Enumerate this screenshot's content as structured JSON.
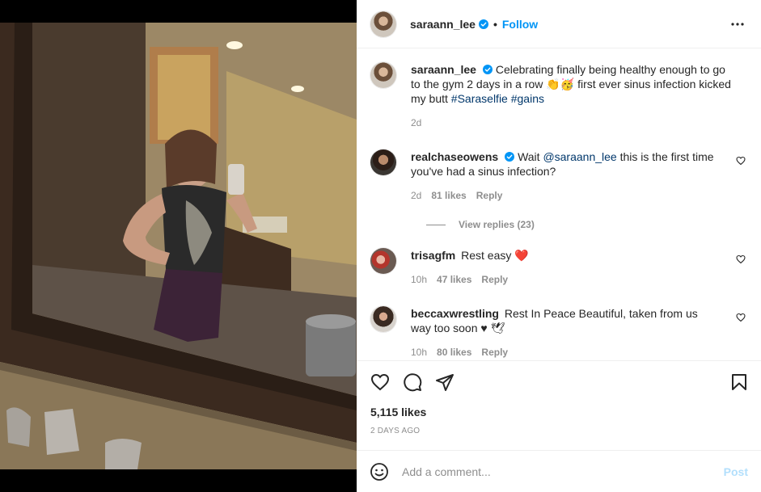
{
  "post": {
    "author": "saraann_lee",
    "follow_label": "Follow",
    "dot": "•",
    "more_icon": "more-horizontal-icon",
    "caption": {
      "text_before": "Celebrating finally being healthy enough to go to the gym 2 days in a row ",
      "emojis": "👏🥳",
      "text_after": " first ever sinus infection kicked my butt ",
      "hashtag1": "#Saraselfie",
      "hashtag2": "#gains",
      "time": "2d"
    }
  },
  "comments": [
    {
      "user": "realchaseowens",
      "verified": true,
      "text_before": "Wait ",
      "mention": "@saraann_lee",
      "text_after": " this is the first time you've had a sinus infection?",
      "time": "2d",
      "likes": "81 likes",
      "reply": "Reply",
      "view_replies": "View replies (23)"
    },
    {
      "user": "trisagfm",
      "verified": false,
      "text": "Rest easy ",
      "emoji": "❤️",
      "time": "10h",
      "likes": "47 likes",
      "reply": "Reply"
    },
    {
      "user": "beccaxwrestling",
      "verified": false,
      "text": "Rest In Peace Beautiful, taken from us way too soon ♥ 🕊",
      "time": "10h",
      "likes": "80 likes",
      "reply": "Reply"
    }
  ],
  "footer": {
    "likes": "5,115 likes",
    "date": "2 DAYS AGO",
    "comment_placeholder": "Add a comment...",
    "post_label": "Post"
  },
  "colors": {
    "accent": "#0095f6",
    "link": "#00376b",
    "muted": "#8e8e8e",
    "heart_red": "#ed4956",
    "post_disabled": "#b2dffc"
  }
}
